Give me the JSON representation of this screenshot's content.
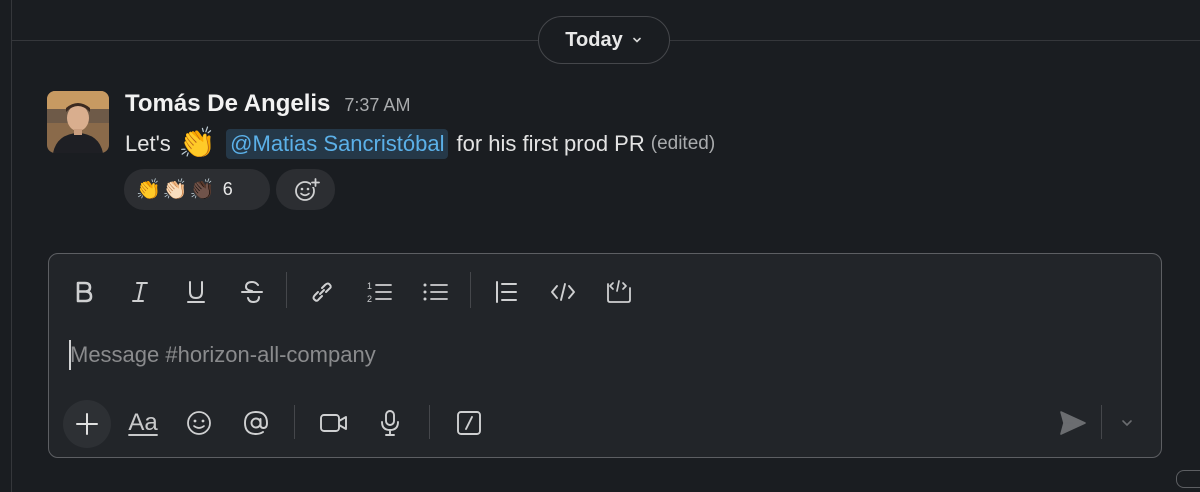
{
  "day_divider": {
    "label": "Today"
  },
  "message": {
    "author": "Tomás De Angelis",
    "time": "7:37 AM",
    "text_before": "Let's",
    "emoji": "👏",
    "mention": "@Matias Sancristóbal",
    "text_after": "for his first prod PR",
    "edited_label": "(edited)"
  },
  "reactions": {
    "emojis": [
      "👏",
      "👏🏻",
      "👏🏿"
    ],
    "count": "6",
    "add_icon": "add-reaction-icon"
  },
  "composer": {
    "placeholder": "Message #horizon-all-company",
    "format_tools": [
      "bold-icon",
      "italic-icon",
      "underline-icon",
      "strikethrough-icon",
      "link-icon",
      "ordered-list-icon",
      "bulleted-list-icon",
      "blockquote-icon",
      "code-icon",
      "code-block-icon"
    ],
    "aa_label": "Aa",
    "bottom_tools": [
      "plus-icon",
      "formatting-toggle",
      "emoji-icon",
      "mention-icon",
      "video-icon",
      "microphone-icon",
      "slash-command-icon",
      "send-icon",
      "chevron-down-icon"
    ]
  },
  "colors": {
    "background": "#1a1d21",
    "composer_bg": "#222529",
    "mention_bg": "#253848",
    "mention_text": "#5bb0e8"
  }
}
